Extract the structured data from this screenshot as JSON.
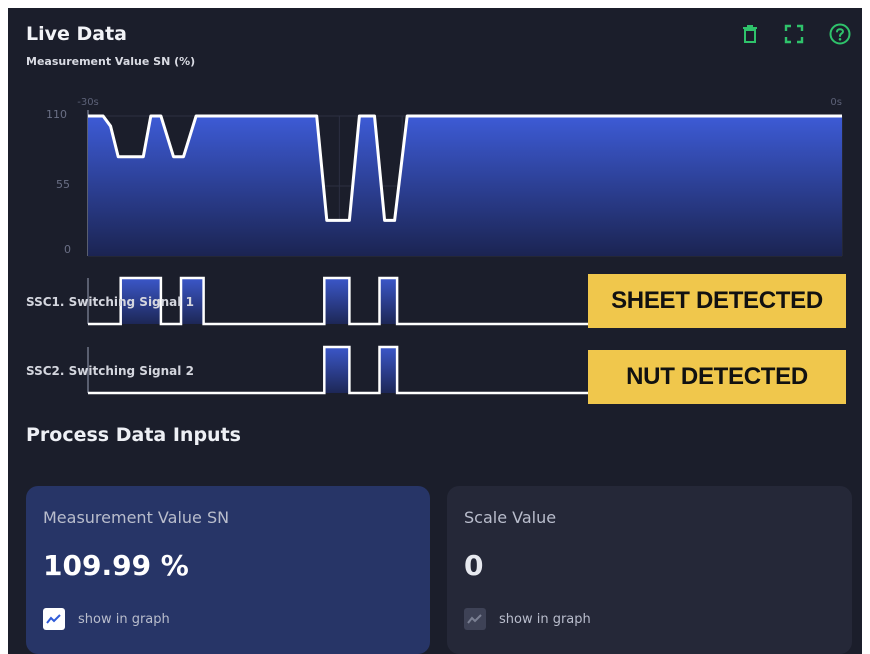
{
  "header": {
    "title": "Live Data",
    "subtitle": "Measurement Value SN (%)",
    "tools": [
      "trash-icon",
      "fullscreen-icon",
      "help-icon"
    ]
  },
  "colors": {
    "accent": "#2fc36b",
    "fill_top": "#3d5bd6",
    "badge": "#f0c74c",
    "background": "#1b1e2b"
  },
  "chart_data": {
    "type": "area",
    "x_start_label": "-30s",
    "x_end_label": "0s",
    "y_ticks": [
      "110",
      "55",
      "0"
    ],
    "ylim": [
      0,
      110
    ],
    "grid": true,
    "x": [
      -30,
      -29.4,
      -29.1,
      -28.8,
      -28.3,
      -27.8,
      -27.5,
      -27.1,
      -26.6,
      -26.2,
      -25.7,
      -25.4,
      -24.6,
      -20.9,
      -20.5,
      -19.6,
      -19.2,
      -18.6,
      -18.2,
      -17.8,
      -17.3,
      -16.9,
      0
    ],
    "values": [
      110,
      110,
      102,
      78,
      78,
      78,
      110,
      110,
      78,
      78,
      110,
      110,
      110,
      110,
      28,
      28,
      110,
      110,
      28,
      28,
      110,
      110,
      110
    ],
    "signals": [
      {
        "name": "SSC1. Switching Signal 1",
        "on_intervals": [
          [
            -28.7,
            -27.1
          ],
          [
            -26.3,
            -25.4
          ],
          [
            -20.6,
            -19.6
          ],
          [
            -18.4,
            -17.7
          ]
        ]
      },
      {
        "name": "SSC2. Switching Signal 2",
        "on_intervals": [
          [
            -20.6,
            -19.6
          ],
          [
            -18.4,
            -17.7
          ]
        ]
      }
    ]
  },
  "annotations": {
    "sheet": "SHEET DETECTED",
    "nut": "NUT DETECTED"
  },
  "process": {
    "title": "Process Data Inputs",
    "cards": [
      {
        "title": "Measurement Value SN",
        "value": "109.99 %",
        "checkbox_label": "show in graph",
        "checked": true
      },
      {
        "title": "Scale Value",
        "value": "0",
        "checkbox_label": "show in graph",
        "checked": false
      }
    ]
  }
}
